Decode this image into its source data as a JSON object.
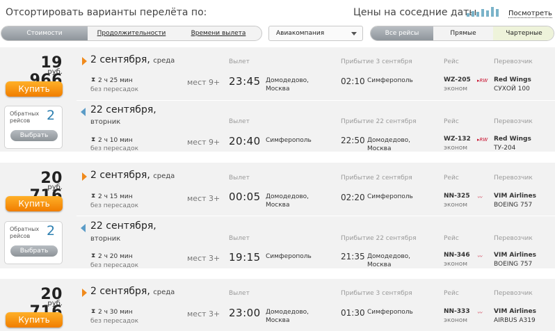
{
  "header": {
    "sort_title": "Отсортировать варианты перелёта по:",
    "prices_title": "Цены на соседние даты",
    "view_link": "Посмотреть",
    "mini_bar_levels": [
      0.35,
      0.55,
      0.45,
      0.75,
      0.6,
      0.9,
      0.7
    ]
  },
  "filters": {
    "sort_tabs": [
      "Стоимости",
      "Продолжительности",
      "Времени вылета"
    ],
    "active_sort": 0,
    "airline_select": "Авиакомпания",
    "flight_tabs": [
      "Все рейсы",
      "Прямые",
      "Чартерные"
    ],
    "active_flight_tab": 0
  },
  "colors": {
    "accent": "#f08a1c",
    "blue": "#2d7fb0",
    "card_bg": "#f2f2f2"
  },
  "labels": {
    "departure": "Вылет",
    "flight": "Рейс",
    "carrier": "Перевозчик",
    "buy": "Купить",
    "choose": "Выбрать",
    "return_flights": "Обратных рейсов",
    "currency": "руб.",
    "nonstop": "без пересадок"
  },
  "offers": [
    {
      "price": "19 966",
      "return_count": "2",
      "legs": [
        {
          "date": "2 сентября",
          "dow": "среда",
          "duration": "2 ч 25 мин",
          "seats": "мест 9+",
          "dep_time": "23:45",
          "dep_place": [
            "Домодедово,",
            "Москва"
          ],
          "arr_header": "Прибытие 3 сентября",
          "arr_time": "02:10",
          "arr_place": [
            "Симферополь"
          ],
          "flight": "WZ-205",
          "class": "эконом",
          "carrier": "Red Wings",
          "plane": "СУХОЙ 100",
          "logo": "red-wings"
        },
        {
          "date": "22 сентября,",
          "dow": "вторник",
          "duration": "2 ч 10 мин",
          "seats": "мест 9+",
          "dep_time": "20:40",
          "dep_place": [
            "Симферополь"
          ],
          "arr_header": "Прибытие 22 сентября",
          "arr_time": "22:50",
          "arr_place": [
            "Домодедово,",
            "Москва"
          ],
          "flight": "WZ-132",
          "class": "эконом",
          "carrier": "Red Wings",
          "plane": "ТУ-204",
          "logo": "red-wings"
        }
      ]
    },
    {
      "price": "20 716",
      "return_count": "2",
      "legs": [
        {
          "date": "2 сентября",
          "dow": "среда",
          "duration": "2 ч 15 мин",
          "seats": "мест 3+",
          "dep_time": "00:05",
          "dep_place": [
            "Домодедово,",
            "Москва"
          ],
          "arr_header": "Прибытие 2 сентября",
          "arr_time": "02:20",
          "arr_place": [
            "Симферополь"
          ],
          "flight": "NN-325",
          "class": "эконом",
          "carrier": "VIM Airlines",
          "plane": "BOEING 757",
          "logo": "vim"
        },
        {
          "date": "22 сентября,",
          "dow": "вторник",
          "duration": "2 ч 20 мин",
          "seats": "мест 3+",
          "dep_time": "19:15",
          "dep_place": [
            "Симферополь"
          ],
          "arr_header": "Прибытие 22 сентября",
          "arr_time": "21:35",
          "arr_place": [
            "Домодедово,",
            "Москва"
          ],
          "flight": "NN-346",
          "class": "эконом",
          "carrier": "VIM Airlines",
          "plane": "BOEING 757",
          "logo": "vim"
        }
      ]
    },
    {
      "price": "20 716",
      "legs": [
        {
          "date": "2 сентября",
          "dow": "среда",
          "duration": "2 ч 30 мин",
          "seats": "мест 3+",
          "dep_time": "23:00",
          "dep_place": [
            "Домодедово,",
            "Москва"
          ],
          "arr_header": "Прибытие 3 сентября",
          "arr_time": "01:30",
          "arr_place": [
            "Симферополь"
          ],
          "flight": "NN-333",
          "class": "эконом",
          "carrier": "VIM Airlines",
          "plane": "AIRBUS A319",
          "logo": "vim"
        }
      ]
    }
  ]
}
